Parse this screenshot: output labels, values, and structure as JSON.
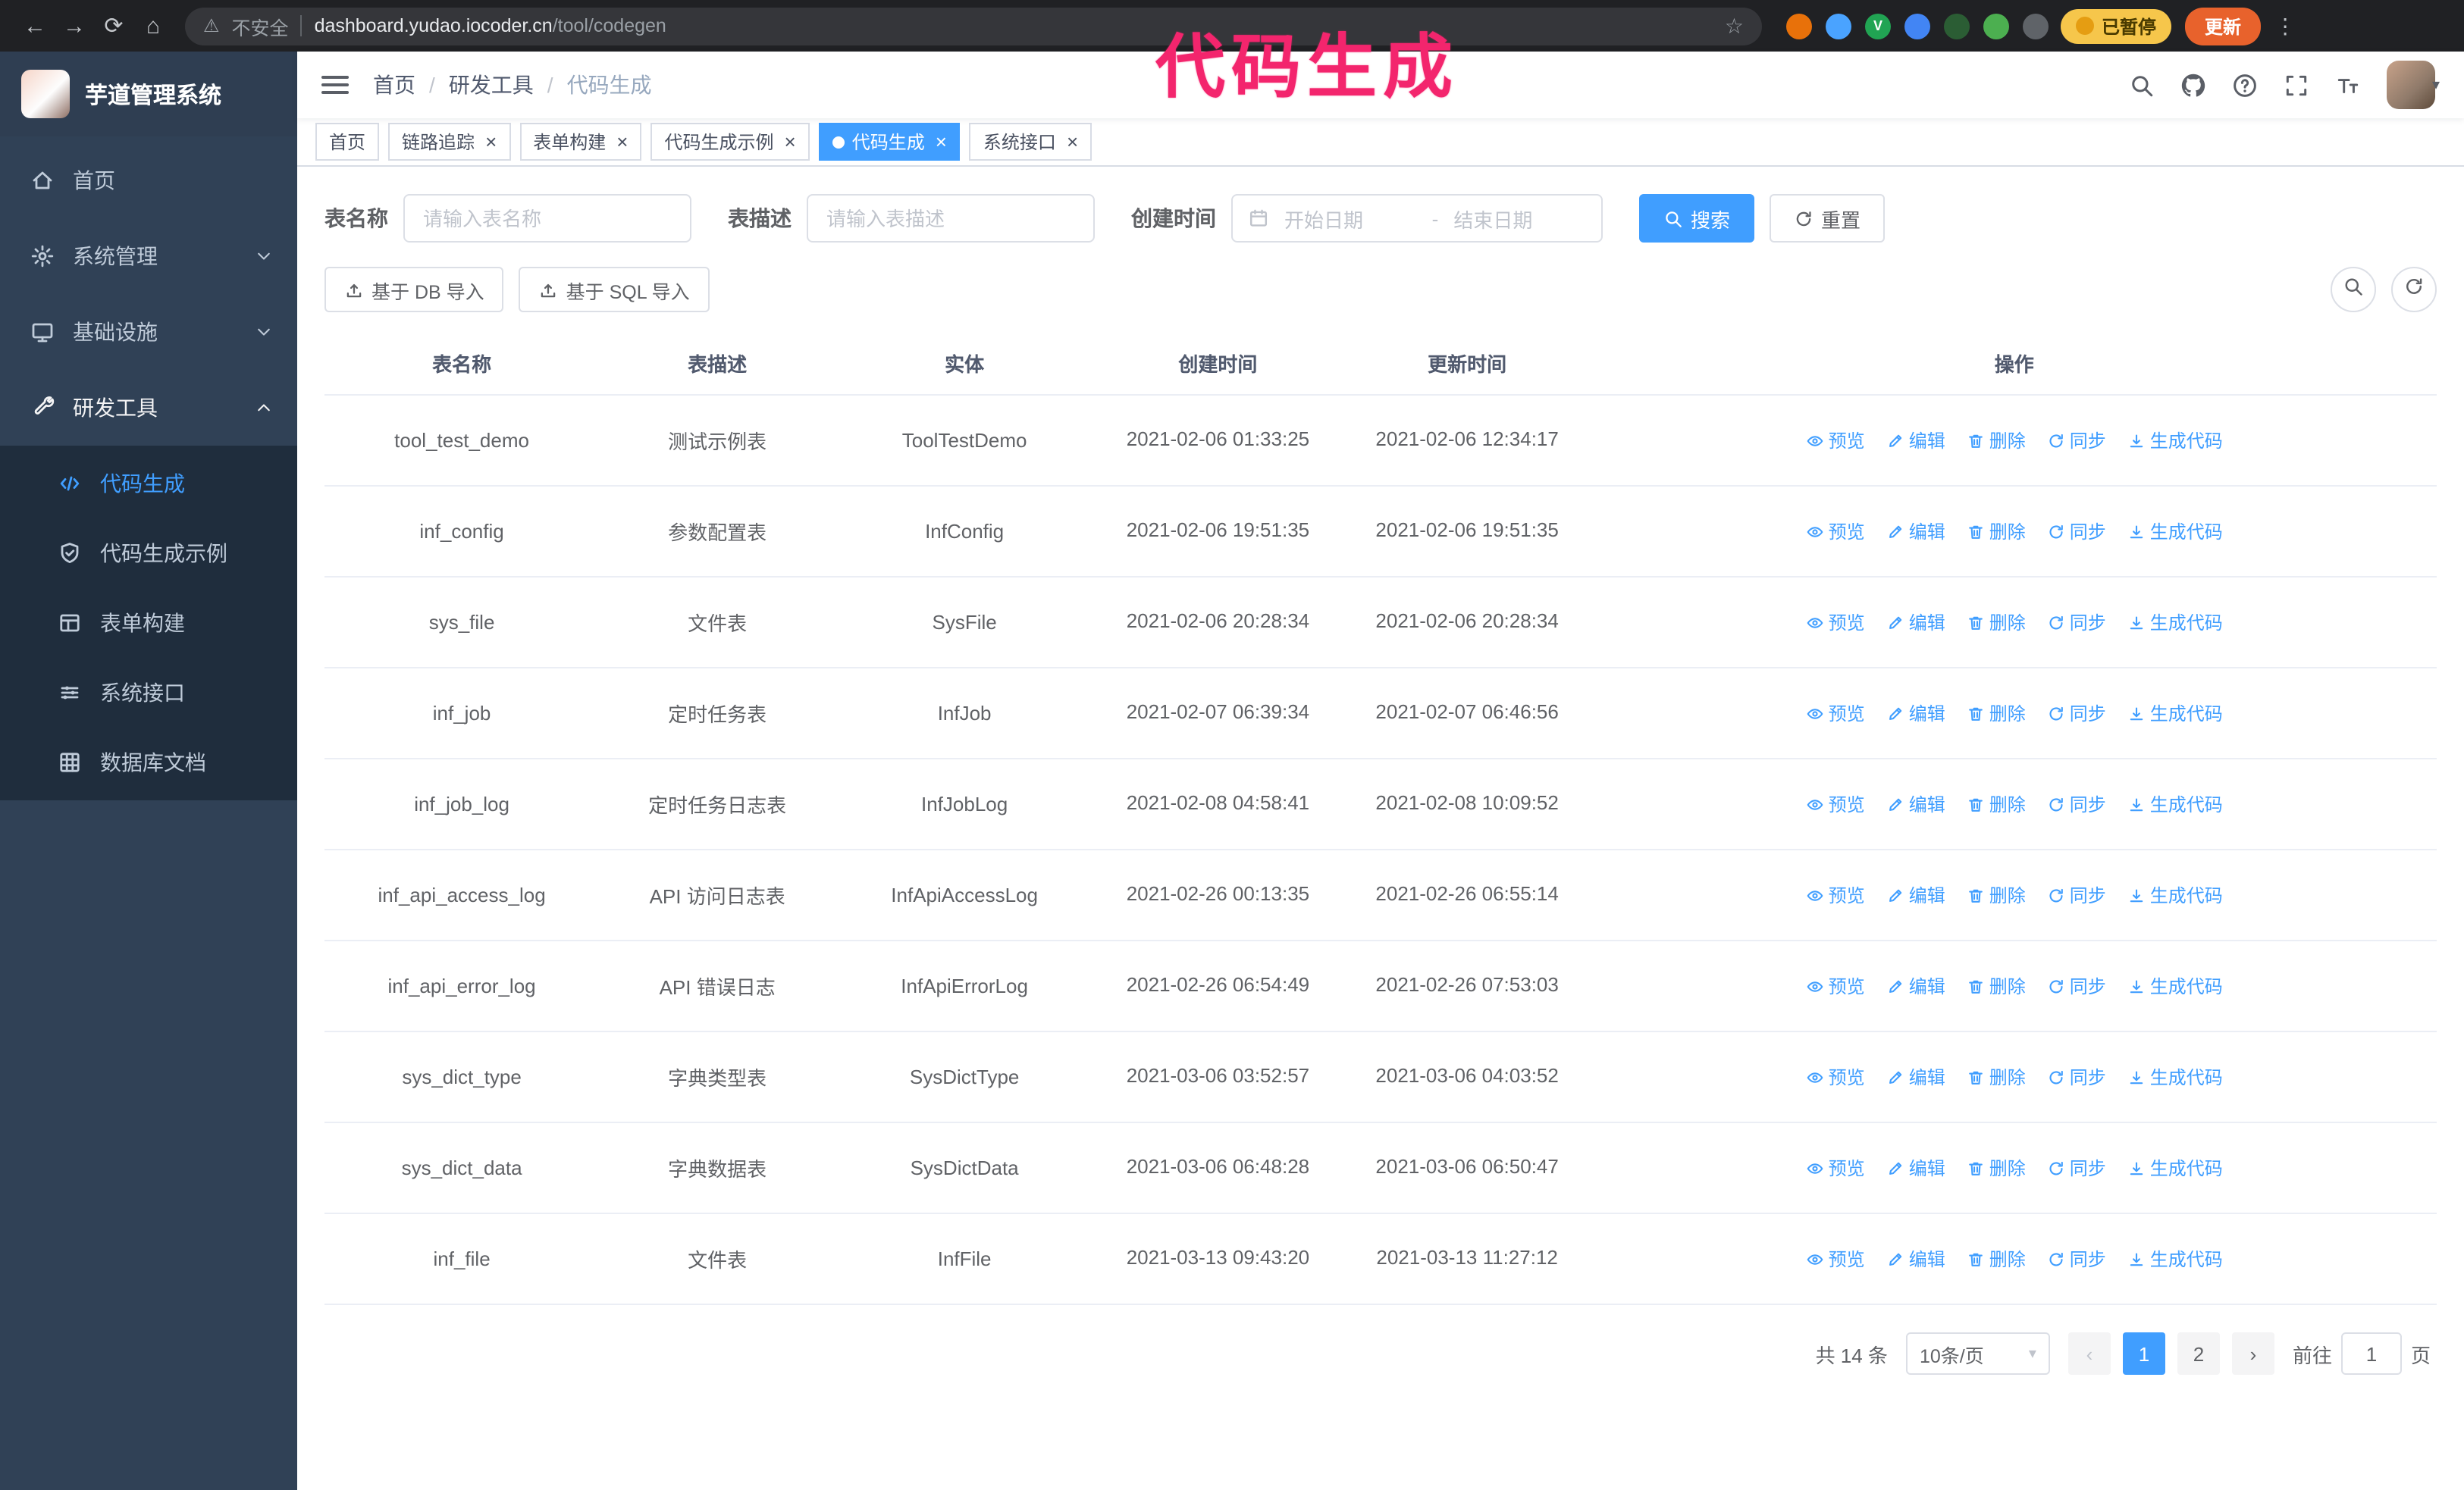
{
  "annotation": {
    "text": "代码生成",
    "color": "#f3256d"
  },
  "browser": {
    "security_label": "不安全",
    "url_host": "dashboard.yudao.iocoder.cn",
    "url_path": "/tool/codegen",
    "paused_label": "已暂停",
    "update_label": "更新",
    "extensions": [
      {
        "name": "extension-fox-icon",
        "color": "#e8710a"
      },
      {
        "name": "extension-drop-icon",
        "color": "#4aa3ff"
      },
      {
        "name": "extension-v-icon",
        "color": "#21a453",
        "glyph": "V"
      },
      {
        "name": "extension-people-icon",
        "color": "#4285f4"
      },
      {
        "name": "extension-wallet-icon",
        "color": "#2b5d34"
      },
      {
        "name": "extension-leaf-icon",
        "color": "#4caf50"
      },
      {
        "name": "extension-pin-icon",
        "color": "#5f6368"
      }
    ]
  },
  "sidebar": {
    "logo_title": "芋道管理系统",
    "items": [
      {
        "key": "home",
        "label": "首页",
        "icon": "home-icon",
        "expandable": false,
        "expanded": false
      },
      {
        "key": "system",
        "label": "系统管理",
        "icon": "gear-icon",
        "expandable": true,
        "expanded": false
      },
      {
        "key": "infra",
        "label": "基础设施",
        "icon": "infra-icon",
        "expandable": true,
        "expanded": false
      },
      {
        "key": "devtools",
        "label": "研发工具",
        "icon": "tools-icon",
        "expandable": true,
        "expanded": true
      }
    ],
    "sub_items": [
      {
        "key": "codegen",
        "label": "代码生成",
        "icon": "code-icon",
        "active": true
      },
      {
        "key": "codegen-example",
        "label": "代码生成示例",
        "icon": "example-icon",
        "active": false
      },
      {
        "key": "form-builder",
        "label": "表单构建",
        "icon": "form-icon",
        "active": false
      },
      {
        "key": "system-api",
        "label": "系统接口",
        "icon": "api-icon",
        "active": false
      },
      {
        "key": "db-doc",
        "label": "数据库文档",
        "icon": "db-icon",
        "active": false
      }
    ]
  },
  "header": {
    "breadcrumb": [
      "首页",
      "研发工具",
      "代码生成"
    ],
    "separator": "/"
  },
  "header_icons": [
    {
      "name": "search-icon"
    },
    {
      "name": "github-icon"
    },
    {
      "name": "help-icon"
    },
    {
      "name": "fullscreen-icon"
    },
    {
      "name": "font-size-icon"
    }
  ],
  "tags": [
    {
      "label": "首页",
      "closable": false,
      "active": false
    },
    {
      "label": "链路追踪",
      "closable": true,
      "active": false
    },
    {
      "label": "表单构建",
      "closable": true,
      "active": false
    },
    {
      "label": "代码生成示例",
      "closable": true,
      "active": false
    },
    {
      "label": "代码生成",
      "closable": true,
      "active": true
    },
    {
      "label": "系统接口",
      "closable": true,
      "active": false
    }
  ],
  "filters": {
    "table_name_label": "表名称",
    "table_name_placeholder": "请输入表名称",
    "table_desc_label": "表描述",
    "table_desc_placeholder": "请输入表描述",
    "create_time_label": "创建时间",
    "date_start_placeholder": "开始日期",
    "date_separator": "-",
    "date_end_placeholder": "结束日期",
    "search_label": "搜索",
    "reset_label": "重置"
  },
  "toolbar": {
    "import_db_label": "基于 DB 导入",
    "import_sql_label": "基于 SQL 导入"
  },
  "table": {
    "columns": [
      "表名称",
      "表描述",
      "实体",
      "创建时间",
      "更新时间",
      "操作"
    ],
    "actions": [
      {
        "key": "preview",
        "label": "预览",
        "icon": "eye-icon"
      },
      {
        "key": "edit",
        "label": "编辑",
        "icon": "edit-icon"
      },
      {
        "key": "delete",
        "label": "删除",
        "icon": "delete-icon"
      },
      {
        "key": "sync",
        "label": "同步",
        "icon": "sync-icon"
      },
      {
        "key": "generate",
        "label": "生成代码",
        "icon": "codegen-icon"
      }
    ],
    "rows": [
      {
        "name": "tool_test_demo",
        "desc": "测试示例表",
        "entity": "ToolTestDemo",
        "created": "2021-02-06 01:33:25",
        "updated": "2021-02-06 12:34:17"
      },
      {
        "name": "inf_config",
        "desc": "参数配置表",
        "entity": "InfConfig",
        "created": "2021-02-06 19:51:35",
        "updated": "2021-02-06 19:51:35"
      },
      {
        "name": "sys_file",
        "desc": "文件表",
        "entity": "SysFile",
        "created": "2021-02-06 20:28:34",
        "updated": "2021-02-06 20:28:34"
      },
      {
        "name": "inf_job",
        "desc": "定时任务表",
        "entity": "InfJob",
        "created": "2021-02-07 06:39:34",
        "updated": "2021-02-07 06:46:56"
      },
      {
        "name": "inf_job_log",
        "desc": "定时任务日志表",
        "entity": "InfJobLog",
        "created": "2021-02-08 04:58:41",
        "updated": "2021-02-08 10:09:52"
      },
      {
        "name": "inf_api_access_log",
        "desc": "API 访问日志表",
        "entity": "InfApiAccessLog",
        "created": "2021-02-26 00:13:35",
        "updated": "2021-02-26 06:55:14"
      },
      {
        "name": "inf_api_error_log",
        "desc": "API 错误日志",
        "entity": "InfApiErrorLog",
        "created": "2021-02-26 06:54:49",
        "updated": "2021-02-26 07:53:03"
      },
      {
        "name": "sys_dict_type",
        "desc": "字典类型表",
        "entity": "SysDictType",
        "created": "2021-03-06 03:52:57",
        "updated": "2021-03-06 04:03:52"
      },
      {
        "name": "sys_dict_data",
        "desc": "字典数据表",
        "entity": "SysDictData",
        "created": "2021-03-06 06:48:28",
        "updated": "2021-03-06 06:50:47"
      },
      {
        "name": "inf_file",
        "desc": "文件表",
        "entity": "InfFile",
        "created": "2021-03-13 09:43:20",
        "updated": "2021-03-13 11:27:12"
      }
    ]
  },
  "pagination": {
    "total_text": "共 14 条",
    "page_size": "10条/页",
    "pages": [
      "1",
      "2"
    ],
    "active_page": "1",
    "goto_label": "前往",
    "goto_value": "1",
    "goto_suffix": "页"
  }
}
